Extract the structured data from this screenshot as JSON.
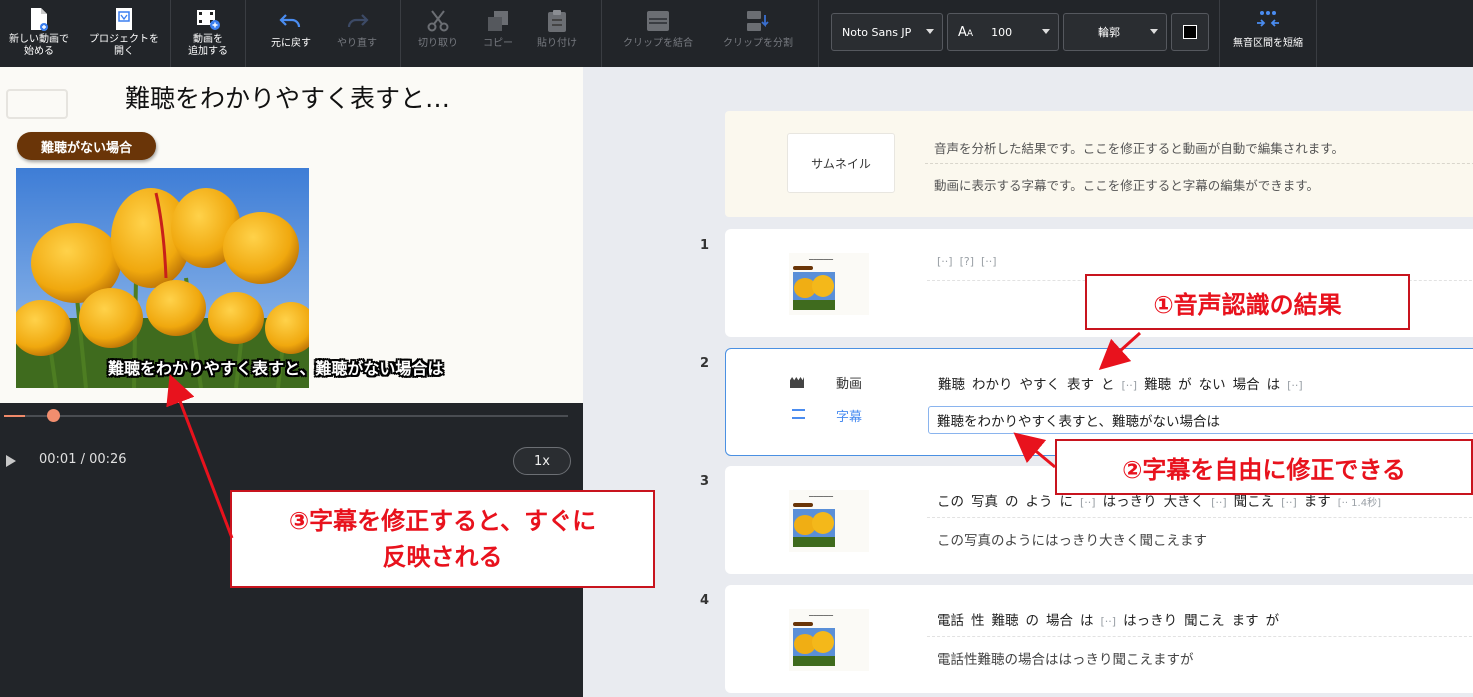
{
  "toolbar": {
    "new_video": "新しい動画で\n始める",
    "open_project": "プロジェクトを\n開く",
    "add_video": "動画を\n追加する",
    "undo": "元に戻す",
    "redo": "やり直す",
    "cut": "切り取り",
    "copy": "コピー",
    "paste": "貼り付け",
    "merge_clips": "クリップを結合",
    "split_clip": "クリップを分割",
    "font_family": "Noto Sans JP",
    "font_size": "100",
    "outline": "輪郭",
    "text_color": "#000000",
    "trim_silence": "無音区間を短縮"
  },
  "preview": {
    "title": "難聴をわかりやすく表すと…",
    "tag": "難聴がない場合",
    "subtitle": "難聴をわかりやすく表すと、難聴がない場合は",
    "time": "00:01 / 00:26",
    "speed": "1x",
    "progress": 0.038
  },
  "editor": {
    "header": {
      "thumbnail_label": "サムネイル",
      "line1": "音声を分析した結果です。ここを修正すると動画が自動で編集されます。",
      "line2": "動画に表示する字幕です。ここを修正すると字幕の編集ができます。"
    },
    "clips": [
      {
        "num": "1",
        "words": [
          "[··]",
          "[?]",
          "[··]"
        ]
      },
      {
        "num": "2",
        "video_label": "動画",
        "subtitle_label": "字幕",
        "words": [
          "難聴",
          "わかり",
          "やすく",
          "表す",
          "と",
          "[··]",
          "難聴",
          "が",
          "ない",
          "場合",
          "は",
          "[··]"
        ],
        "subtitle": "難聴をわかりやすく表すと、難聴がない場合は"
      },
      {
        "num": "3",
        "words": [
          "この",
          "写真",
          "の",
          "よう",
          "に",
          "[··]",
          "はっきり",
          "大きく",
          "[··]",
          "聞こえ",
          "[··]",
          "ます",
          "[·· 1.4秒]"
        ],
        "subtitle": "この写真のようにはっきり大きく聞こえます"
      },
      {
        "num": "4",
        "words": [
          "電話",
          "性",
          "難聴",
          "の",
          "場合",
          "は",
          "[··]",
          "はっきり",
          "聞こえ",
          "ます",
          "が"
        ],
        "subtitle": "電話性難聴の場合ははっきり聞こえますが"
      }
    ]
  },
  "annotations": {
    "callout1": "①音声認識の結果",
    "callout2": "②字幕を自由に修正できる",
    "callout3": "③字幕を修正すると、すぐに\n反映される"
  },
  "colors": {
    "accent": "#f28e6e",
    "tag_brown": "#6a3508",
    "callout_red": "#e8121d",
    "toolbar_bg": "#222529",
    "selected_border": "#4a90e2"
  }
}
